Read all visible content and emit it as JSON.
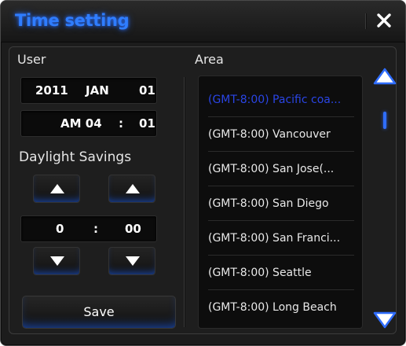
{
  "window": {
    "title": "Time setting",
    "close_icon": "close-icon"
  },
  "user": {
    "label": "User",
    "date": {
      "year": "2011",
      "month": "JAN",
      "day": "01"
    },
    "time": {
      "ampm_hour": "AM 04",
      "separator": ":",
      "minute": "01"
    }
  },
  "daylight": {
    "label": "Daylight Savings",
    "hours": "0",
    "separator": ":",
    "minutes": "00",
    "up_icon": "triangle-up-icon",
    "down_icon": "triangle-down-icon"
  },
  "save_label": "Save",
  "area": {
    "label": "Area",
    "items": [
      {
        "label": "(GMT-8:00) Pacific coa..."
      },
      {
        "label": "(GMT-8:00) Vancouver"
      },
      {
        "label": "(GMT-8:00) San Jose(..."
      },
      {
        "label": "(GMT-8:00) San Diego"
      },
      {
        "label": "(GMT-8:00) San Franci..."
      },
      {
        "label": "(GMT-8:00) Seattle"
      },
      {
        "label": "(GMT-8:00) Long Beach"
      }
    ],
    "selected_index": 0,
    "scroll_up_icon": "scroll-up-icon",
    "scroll_down_icon": "scroll-down-icon"
  },
  "colors": {
    "accent": "#2f7dff",
    "selected_text": "#2a45e6",
    "background": "#1c1c1c"
  }
}
